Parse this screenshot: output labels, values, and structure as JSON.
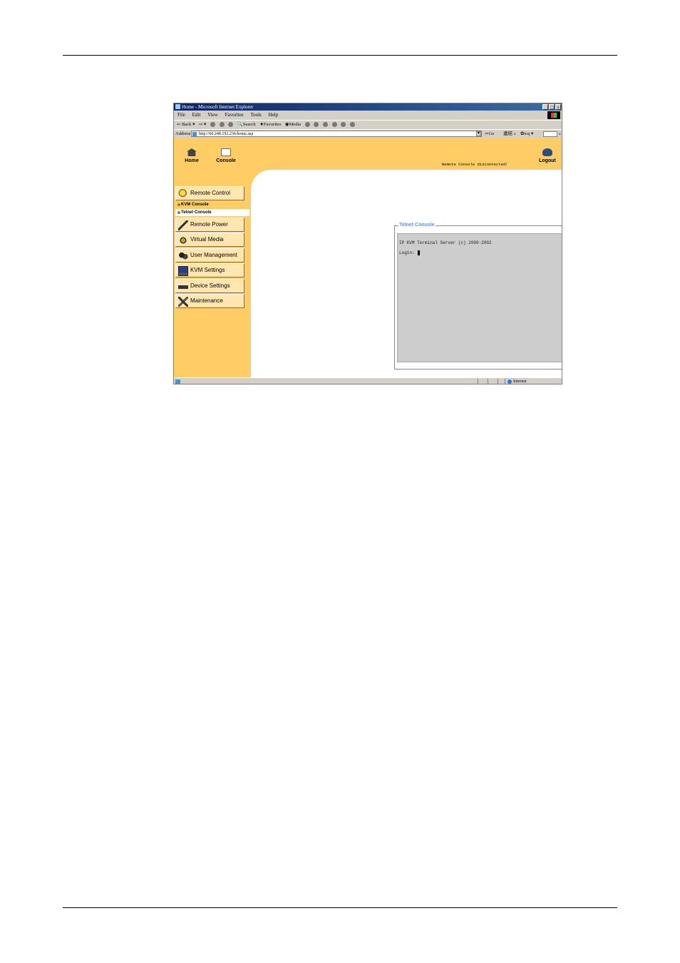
{
  "browser": {
    "title": "Home - Microsoft Internet Explorer",
    "window_buttons": [
      "_",
      "&#38;",
      "×"
    ],
    "menu": [
      "File",
      "Edit",
      "View",
      "Favorites",
      "Tools",
      "Help"
    ],
    "toolbar": {
      "back": "Back",
      "search": "Search",
      "favorites": "Favorites",
      "media": "Media"
    },
    "address": {
      "label": "Address",
      "url": "http://60.248.192.236/home.asp",
      "go": "Go",
      "links": "連結",
      "icq": "icq",
      "more": "»"
    },
    "status": {
      "zone": "Internet"
    }
  },
  "app": {
    "header": {
      "home": "Home",
      "console": "Console",
      "logout": "Logout",
      "status_message": "Remote Console disconnected!"
    },
    "sidebar": {
      "items": [
        {
          "label": "Remote Control",
          "icon": "remote-control-icon"
        },
        {
          "label": "Remote Power",
          "icon": "remote-power-icon"
        },
        {
          "label": "Virtual Media",
          "icon": "virtual-media-icon"
        },
        {
          "label": "User Management",
          "icon": "user-management-icon"
        },
        {
          "label": "KVM Settings",
          "icon": "kvm-settings-icon"
        },
        {
          "label": "Device Settings",
          "icon": "device-settings-icon"
        },
        {
          "label": "Maintenance",
          "icon": "maintenance-icon"
        }
      ],
      "subitems": [
        {
          "label": "KVM Console",
          "active": false
        },
        {
          "label": "Telnet Console",
          "active": true
        }
      ]
    },
    "telnet": {
      "legend": "Telnet Console",
      "line1": "IP KVM Terminal Server (c) 2000-2002",
      "line2": "Login:"
    }
  },
  "colors": {
    "panel_orange": "#ffcc66",
    "legend_blue": "#6b8fd4",
    "terminal_gray": "#cccccc"
  }
}
